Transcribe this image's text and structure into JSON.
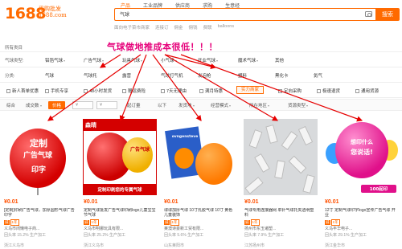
{
  "header": {
    "logo": "1688",
    "logo_sub": "采购批发 1688.com",
    "search_tabs": [
      "产品",
      "工业品牌",
      "供应商",
      "求购",
      "生意经"
    ],
    "search_value": "气球",
    "search_button": "搜索",
    "hot_words": [
      "面向电子菜市商家",
      "连接订",
      "佣金",
      "佣钱",
      "费联",
      "balloons"
    ]
  },
  "promo_text": "气球做地推成本很低！！！",
  "all_categories": "所有类目",
  "filters": {
    "row1": {
      "label": "气球类型:",
      "options": [
        "铝箔气球",
        "广告气球",
        "玩具气球",
        "小气球",
        "开业气球",
        "魔术气球",
        "其他"
      ]
    },
    "row2": {
      "label": "分类:",
      "options": [
        "气球",
        "气球托",
        "露营",
        "气球打气机",
        "发泡枪",
        "塑料",
        "黑化卡",
        "氦气"
      ]
    },
    "row3": {
      "label": "",
      "options": [
        "新人首单优惠",
        "手机专享",
        "48小时发货",
        "赠运费险",
        "7天无理由",
        "满月特惠",
        "实力商家",
        "定向采购",
        "极速退货",
        "通用货源"
      ],
      "highlight": "实力商家"
    },
    "row4": {
      "label": "综合",
      "options": [
        "成交数",
        "价格",
        "¥-",
        "¥",
        "确定",
        "起订量",
        "以下",
        "经营模式",
        "所在地区",
        "实力商家",
        "官方店铺",
        "货源类型"
      ]
    }
  },
  "sort": {
    "items": [
      "综合",
      "成交数",
      "价格",
      "起订量",
      "以下",
      "发货地",
      "经营模式",
      "所在地区",
      "货源类型"
    ],
    "selected": "价格"
  },
  "products": [
    {
      "price": "¥0.01",
      "title": "[定制]印刷广告气球，加厚圆形气球广告印字",
      "highlight": "定制印刷",
      "year": "1年",
      "shop": "义乌市闭懒电子商...",
      "stats": "回头率 15.2%  生产加工",
      "location": "浙江义乌市",
      "image_label_line1": "定制",
      "image_label_line2": "广告气球",
      "image_label_line3": "印字"
    },
    {
      "price": "¥0.01",
      "title": "定制气球批发广告气球印刷logo儿童宝宝节气球",
      "highlight": "气球",
      "year": "1年",
      "shop": "义乌市明娜玩具有限...",
      "stats": "回头率 25.2%  生产加工",
      "location": "浙江义乌市",
      "image_label_line1": "森晴",
      "image_label_line2": "广告气球",
      "image_label_line3": "定制印刷您的专属气球"
    },
    {
      "price": "¥0.01",
      "title": "球球加厚气球 10寸乳胶气球 10寸 黄色 儿童装饰",
      "highlight": "气球",
      "year": "1年",
      "shop": "莱澳诗豪新工贸有限...",
      "stats": "回头率 5.6%  生产加工",
      "location": "山东莱阳市",
      "image_label_line1": "ovngensteve",
      "image_label_line2": "",
      "image_label_line3": ""
    },
    {
      "price": "¥0.01",
      "title": "气球专用连接器网 单针气球托夹透明塑料",
      "highlight": "气球",
      "year": "1年",
      "shop": "扬州市东玉诸塑...",
      "stats": "回头率 7.9%  生产加工",
      "location": "江苏扬州市",
      "image_label_line1": "",
      "image_label_line2": "",
      "image_label_line3": ""
    },
    {
      "price": "¥0.01",
      "title": "12寸 定制气球印字logo宣传广告气球 开业",
      "highlight": "气球",
      "year": "1年",
      "shop": "义乌丰华电子...",
      "stats": "回头率 29.1%  生产加工",
      "location": "浙江金华市",
      "image_label_line1": "想印什么",
      "image_label_line2": "您说话!",
      "image_label_line3": "100起印"
    }
  ],
  "colors": {
    "accent": "#ff6a00",
    "promo": "#e6007a",
    "price": "#ff5000"
  }
}
